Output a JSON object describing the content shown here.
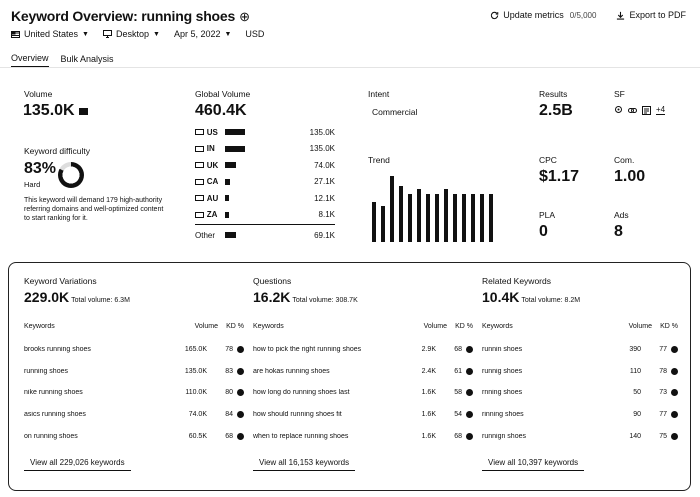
{
  "header": {
    "title": "Keyword Overview: running shoes",
    "add_symbol": "⊕",
    "update_label": "Update metrics",
    "limit": "0/5,000",
    "export_label": "Export to PDF"
  },
  "filters": {
    "country": "United States",
    "device": "Desktop",
    "date": "Apr 5, 2022",
    "currency": "USD"
  },
  "tabs": [
    "Overview",
    "Bulk Analysis"
  ],
  "volume": {
    "label": "Volume",
    "value": "135.0K"
  },
  "kd": {
    "label": "Keyword difficulty",
    "value": "83%",
    "level": "Hard",
    "percent": 83,
    "description": "This keyword will demand 179 high-authority referring domains and well-optimized content to start ranking for it."
  },
  "global_volume": {
    "label": "Global Volume",
    "value": "460.4K",
    "rows": [
      {
        "code": "US",
        "value": "135.0K",
        "share": 0.22
      },
      {
        "code": "IN",
        "value": "135.0K",
        "share": 0.22
      },
      {
        "code": "UK",
        "value": "74.0K",
        "share": 0.12
      },
      {
        "code": "CA",
        "value": "27.1K",
        "share": 0.05
      },
      {
        "code": "AU",
        "value": "12.1K",
        "share": 0.02
      },
      {
        "code": "ZA",
        "value": "8.1K",
        "share": 0.02
      }
    ],
    "other_label": "Other",
    "other_value": "69.1K",
    "other_share": 0.12
  },
  "intent": {
    "label": "Intent",
    "value": "Commercial"
  },
  "trend": {
    "label": "Trend",
    "values": [
      0.6,
      0.55,
      1.0,
      0.85,
      0.72,
      0.8,
      0.72,
      0.72,
      0.8,
      0.72,
      0.72,
      0.72,
      0.72,
      0.72
    ]
  },
  "results": {
    "label": "Results",
    "value": "2.5B"
  },
  "sf": {
    "label": "SF",
    "more": "+4"
  },
  "cpc": {
    "label": "CPC",
    "value": "$1.17"
  },
  "com": {
    "label": "Com.",
    "value": "1.00"
  },
  "pla": {
    "label": "PLA",
    "value": "0"
  },
  "ads": {
    "label": "Ads",
    "value": "8"
  },
  "sections": [
    {
      "title": "Keyword Variations",
      "count": "229.0K",
      "total": "Total volume: 6.3M",
      "headers": [
        "Keywords",
        "Volume",
        "KD %"
      ],
      "rows": [
        {
          "kw": "brooks running shoes",
          "vol": "165.0K",
          "kd": "78"
        },
        {
          "kw": "running shoes",
          "vol": "135.0K",
          "kd": "83"
        },
        {
          "kw": "nike running shoes",
          "vol": "110.0K",
          "kd": "80"
        },
        {
          "kw": "asics running shoes",
          "vol": "74.0K",
          "kd": "84"
        },
        {
          "kw": "on running shoes",
          "vol": "60.5K",
          "kd": "68"
        }
      ],
      "view_all": "View all 229,026 keywords"
    },
    {
      "title": "Questions",
      "count": "16.2K",
      "total": "Total volume: 308.7K",
      "headers": [
        "Keywords",
        "Volume",
        "KD %"
      ],
      "rows": [
        {
          "kw": "how to pick the right running shoes",
          "vol": "2.9K",
          "kd": "68"
        },
        {
          "kw": "are hokas running shoes",
          "vol": "2.4K",
          "kd": "61"
        },
        {
          "kw": "how long do running shoes last",
          "vol": "1.6K",
          "kd": "58"
        },
        {
          "kw": "how should running shoes fit",
          "vol": "1.6K",
          "kd": "54"
        },
        {
          "kw": "when to replace running shoes",
          "vol": "1.6K",
          "kd": "68"
        }
      ],
      "view_all": "View all 16,153 keywords"
    },
    {
      "title": "Related Keywords",
      "count": "10.4K",
      "total": "Total volume: 8.2M",
      "headers": [
        "Keywords",
        "Volume",
        "KD %"
      ],
      "rows": [
        {
          "kw": "runnin shoes",
          "vol": "390",
          "kd": "77"
        },
        {
          "kw": "runnig shoes",
          "vol": "110",
          "kd": "78"
        },
        {
          "kw": "rnning shoes",
          "vol": "50",
          "kd": "73"
        },
        {
          "kw": "rinning shoes",
          "vol": "90",
          "kd": "77"
        },
        {
          "kw": "runnign shoes",
          "vol": "140",
          "kd": "75"
        }
      ],
      "view_all": "View all 10,397 keywords"
    }
  ]
}
